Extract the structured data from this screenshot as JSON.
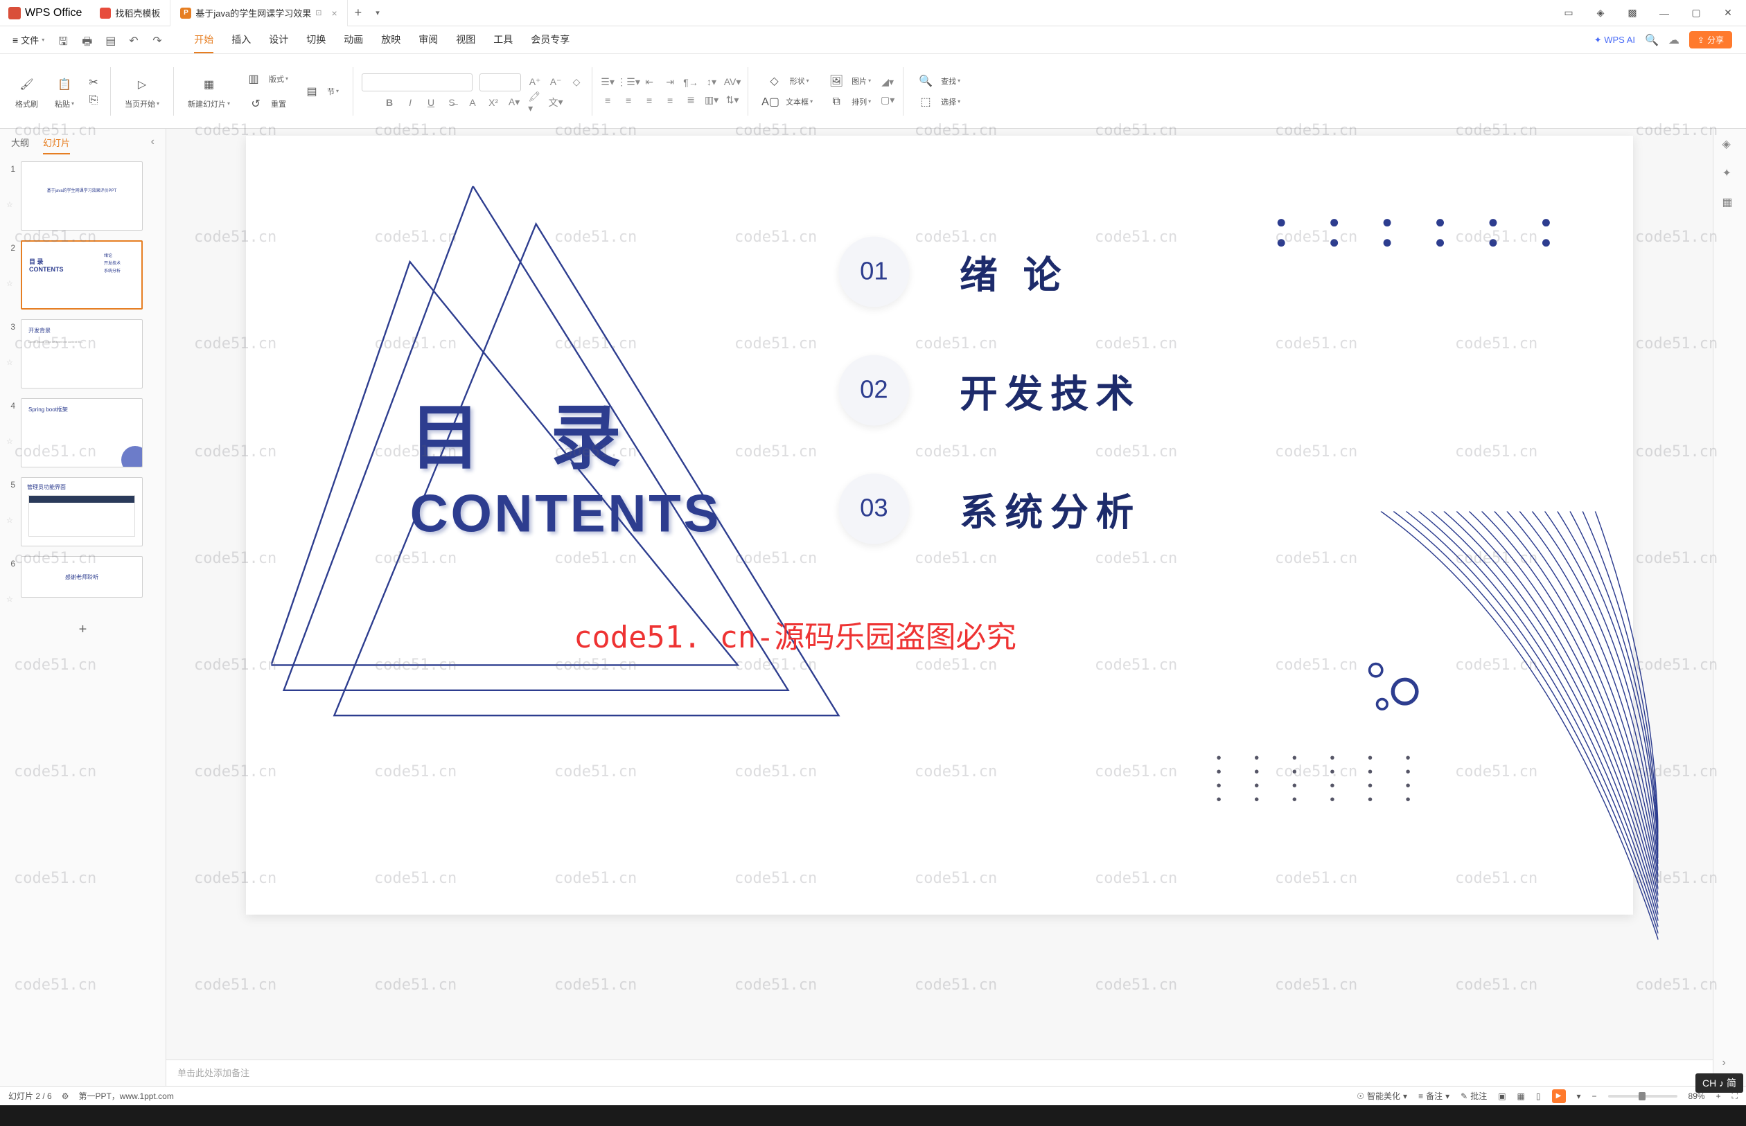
{
  "app": {
    "name": "WPS Office"
  },
  "tabs": [
    {
      "label": "找稻壳模板",
      "iconColor": "#e74c3c"
    },
    {
      "label": "基于java的学生网课学习效果",
      "iconColor": "#e67e22",
      "iconLetter": "P",
      "active": true
    }
  ],
  "menubar": {
    "file": "文件",
    "mainTabs": [
      "开始",
      "插入",
      "设计",
      "切换",
      "动画",
      "放映",
      "审阅",
      "视图",
      "工具",
      "会员专享"
    ],
    "activeMainTab": "开始",
    "wpsAi": "WPS AI",
    "share": "分享"
  },
  "ribbon": {
    "formatPainter": "格式刷",
    "paste": "粘贴",
    "fromCurrent": "当页开始",
    "newSlide": "新建幻灯片",
    "layout": "版式",
    "section": "节",
    "reset": "重置",
    "textEffect": "文",
    "shape": "形状",
    "picture": "图片",
    "textbox": "文本框",
    "arrange": "排列",
    "find": "查找",
    "select": "选择"
  },
  "sidebar": {
    "tabs": [
      "大纲",
      "幻灯片"
    ],
    "activeTab": "幻灯片",
    "slides": [
      {
        "num": "1",
        "title": "基于java的学生网课学习效果评价PPT"
      },
      {
        "num": "2",
        "title": "目录 CONTENTS",
        "items": [
          "绪论",
          "开发技术",
          "系统分析"
        ]
      },
      {
        "num": "3",
        "title": "开发背景"
      },
      {
        "num": "4",
        "title": "Spring boot框架"
      },
      {
        "num": "5",
        "title": "管理员功能界面"
      },
      {
        "num": "6",
        "title": "感谢老师聆听"
      }
    ]
  },
  "slide": {
    "titleCn": "目 录",
    "titleEn": "CONTENTS",
    "toc": [
      {
        "num": "01",
        "text": "绪  论"
      },
      {
        "num": "02",
        "text": "开发技术"
      },
      {
        "num": "03",
        "text": "系统分析"
      }
    ],
    "watermarkRed": "code51. cn-源码乐园盗图必究"
  },
  "notes": {
    "placeholder": "单击此处添加备注"
  },
  "statusbar": {
    "slideCount": "幻灯片 2 / 6",
    "footer": "第一PPT，www.1ppt.com",
    "smartBeautify": "智能美化",
    "notesBtn": "备注",
    "commentsBtn": "批注",
    "zoom": "89%"
  },
  "ime": "CH ♪ 简",
  "watermarkText": "code51.cn"
}
